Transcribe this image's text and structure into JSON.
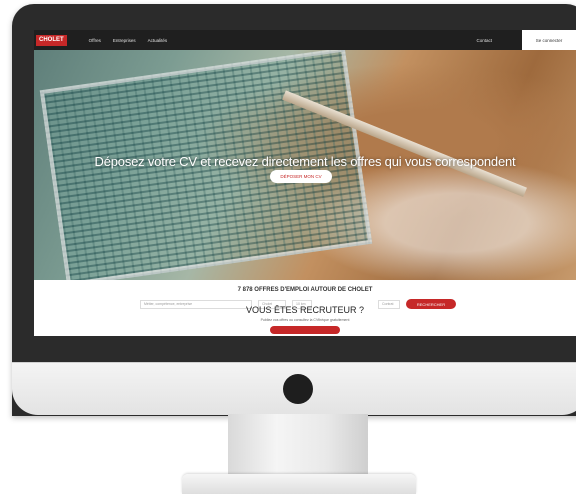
{
  "header": {
    "logo": "CHOLET",
    "nav": [
      "Offres",
      "Entreprises",
      "Actualités"
    ],
    "contact": "Contact",
    "login": "Se connecter"
  },
  "hero": {
    "title": "Déposez votre CV et recevez directement les offres qui vous correspondent",
    "button": "DÉPOSER MON CV"
  },
  "search": {
    "title": "7 878 OFFRES D'EMPLOI AUTOUR DE CHOLET",
    "keyword_placeholder": "Métier, compétence, entreprise",
    "where_placeholder": "Cholet",
    "radius_value": "10 km",
    "type_placeholder": "Contrat",
    "button": "RECHERCHER"
  },
  "recruiter": {
    "title": "VOUS ÊTES RECRUTEUR ?",
    "subtitle": "Publiez vos offres ou consultez la CVthèque gratuitement"
  },
  "colors": {
    "accent": "#c62828",
    "topbar": "#1f1f1f"
  }
}
